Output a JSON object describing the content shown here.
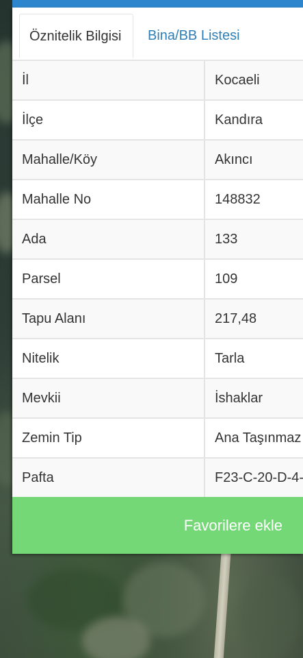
{
  "tabs": [
    {
      "label": "Öznitelik Bilgisi",
      "active": true
    },
    {
      "label": "Bina/BB Listesi",
      "active": false
    }
  ],
  "attributes": [
    {
      "key": "İl",
      "value": "Kocaeli"
    },
    {
      "key": "İlçe",
      "value": "Kandıra"
    },
    {
      "key": "Mahalle/Köy",
      "value": "Akıncı"
    },
    {
      "key": "Mahalle No",
      "value": "148832"
    },
    {
      "key": "Ada",
      "value": "133"
    },
    {
      "key": "Parsel",
      "value": "109"
    },
    {
      "key": "Tapu Alanı",
      "value": "217,48"
    },
    {
      "key": "Nitelik",
      "value": "Tarla"
    },
    {
      "key": "Mevkii",
      "value": "İshaklar"
    },
    {
      "key": "Zemin Tip",
      "value": "Ana Taşınmaz"
    },
    {
      "key": "Pafta",
      "value": "F23-C-20-D-4-"
    }
  ],
  "favorite_button": {
    "label": "Favorilere ekle"
  },
  "colors": {
    "header_bar": "#2d86cd",
    "tab_link": "#2e7fb8",
    "button_green": "#74d876",
    "cell_border": "#e4e4e4"
  }
}
